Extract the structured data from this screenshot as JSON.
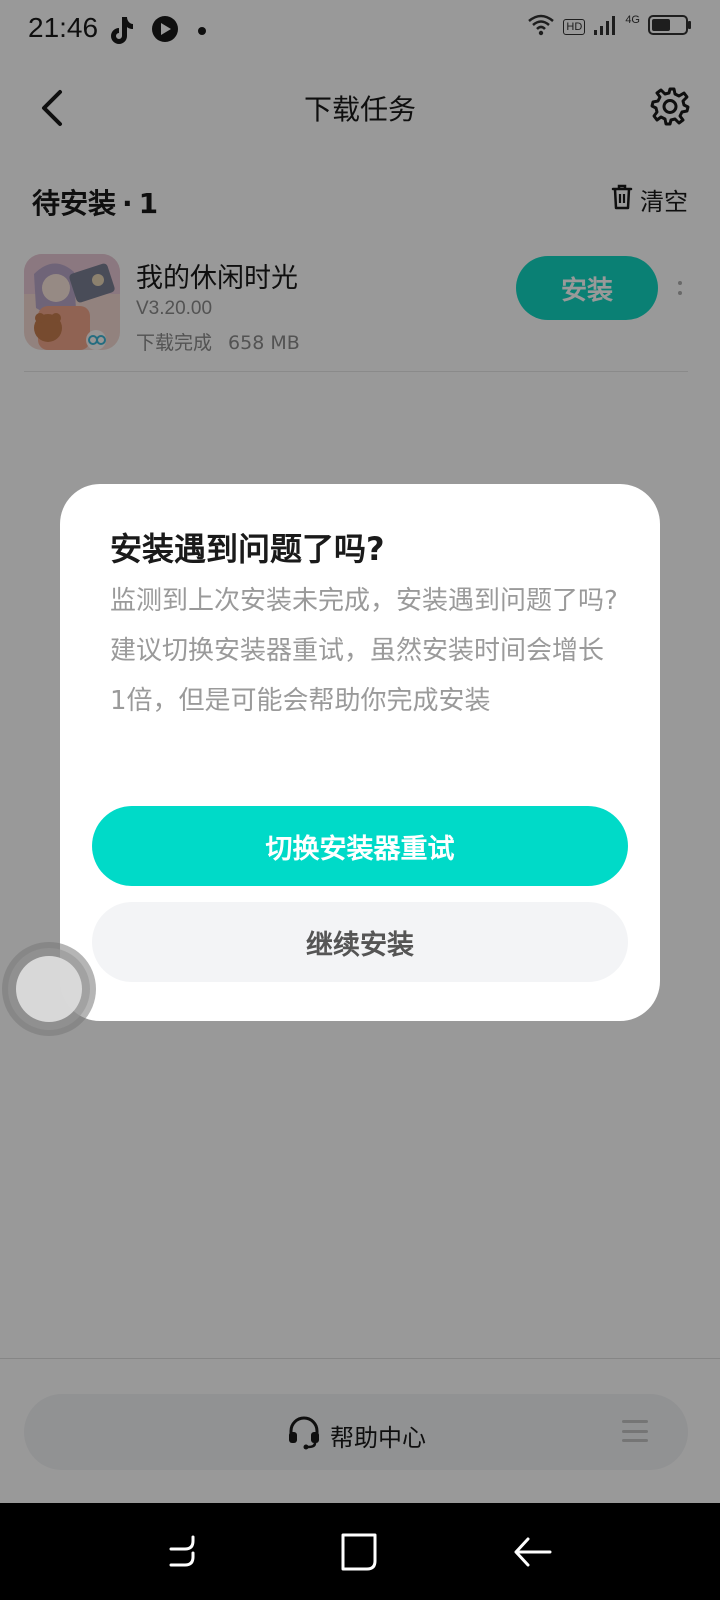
{
  "status_bar": {
    "time": "21:46",
    "left_icons": [
      "tiktok-icon",
      "play-icon",
      "dot-icon"
    ],
    "right_icons": [
      "wifi-icon",
      "hd-badge",
      "signal-icon",
      "battery-icon"
    ],
    "hd_label": "HD",
    "network_label": "4G"
  },
  "header": {
    "title": "下载任务",
    "back_icon": "chevron-left-icon",
    "settings_icon": "gear-icon"
  },
  "section": {
    "title": "待安装",
    "separator": "·",
    "count": "1",
    "clear_label": "清空",
    "clear_icon": "trash-icon"
  },
  "app": {
    "name": "我的休闲时光",
    "version": "V3.20.00",
    "status": "下载完成",
    "size": "658 MB",
    "install_label": "安装",
    "more_icon": "more-vertical-icon"
  },
  "dialog": {
    "title": "安装遇到问题了吗?",
    "body_line1": "监测到上次安装未完成，安装遇到问题了吗?",
    "body_line2": "建议切换安装器重试，虽然安装时间会增长1倍，但是可能会帮助你完成安装",
    "primary_label": "切换安装器重试",
    "secondary_label": "继续安装"
  },
  "bottom": {
    "help_label": "帮助中心",
    "help_icon": "headset-icon",
    "menu_icon": "menu-icon"
  },
  "colors": {
    "accent": "#00dac8",
    "install_button": "#12d6c2",
    "overlay": "rgba(0,0,0,0.40)",
    "secondary_button_bg": "#f3f4f6",
    "body_text_gray": "#9a9a9a"
  },
  "nav": {
    "icons": [
      "recents-icon",
      "home-icon",
      "back-icon"
    ]
  }
}
